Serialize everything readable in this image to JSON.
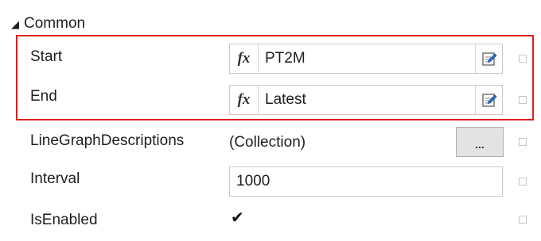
{
  "section": {
    "title": "Common",
    "collapse_glyph": "◢"
  },
  "rows": {
    "start": {
      "label": "Start",
      "value": "PT2M",
      "fx": "fx"
    },
    "end": {
      "label": "End",
      "value": "Latest",
      "fx": "fx"
    },
    "line_graph": {
      "label": "LineGraphDescriptions",
      "value": "(Collection)",
      "button": "..."
    },
    "interval": {
      "label": "Interval",
      "value": "1000"
    },
    "is_enabled": {
      "label": "IsEnabled",
      "checked": true,
      "check_glyph": "✔"
    }
  },
  "colors": {
    "highlight": "#e02020",
    "edit_icon": "#2c6ec8"
  }
}
